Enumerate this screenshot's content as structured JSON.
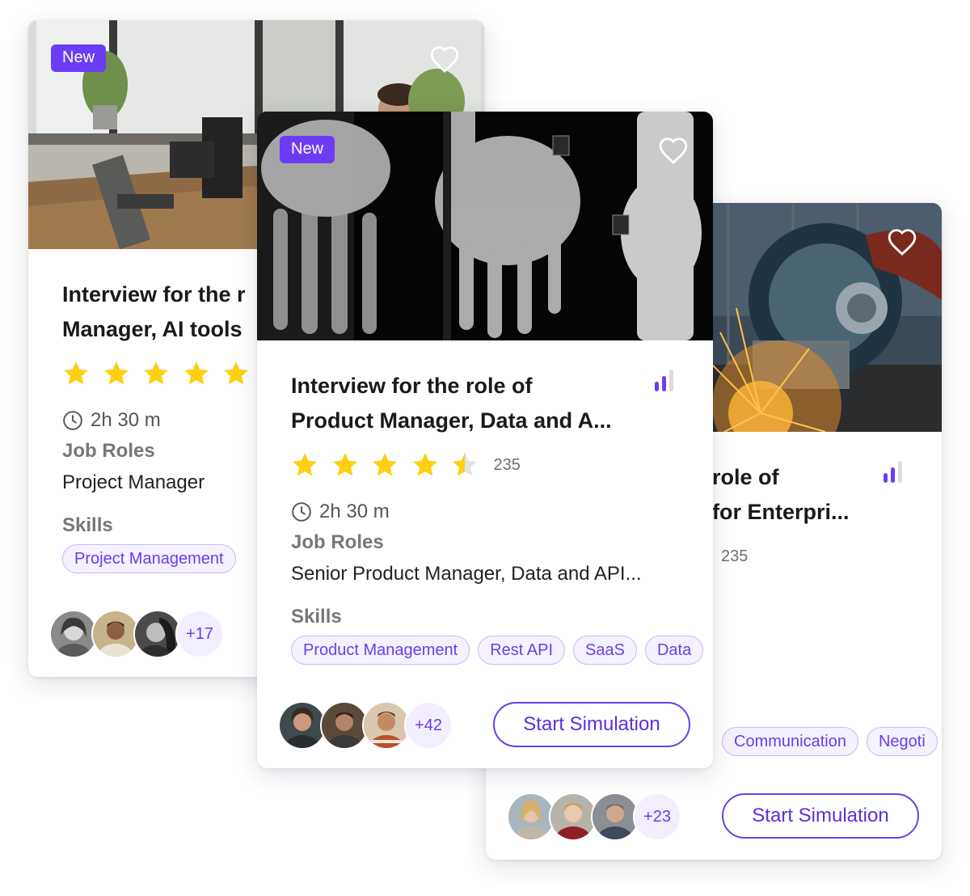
{
  "colors": {
    "accent": "#6c3cf5",
    "star": "#ffcf10",
    "chip_bg": "#f5f1ff",
    "chip_border": "#c9b8fb"
  },
  "cards": [
    {
      "badge": "New",
      "title_line1": "Interview for the r",
      "title_line2": "Manager, AI tools",
      "rating": 5,
      "duration": "2h 30 m",
      "job_roles_label": "Job Roles",
      "job_roles_value": "Project Manager",
      "skills_label": "Skills",
      "skills": [
        "Project Management"
      ],
      "participants_more": "+17",
      "image": "office-desk-photo"
    },
    {
      "badge": "New",
      "title_line1": "Interview for the role of",
      "title_line2": "Product Manager, Data and A...",
      "rating": 4.5,
      "rating_count": "235",
      "duration": "2h 30 m",
      "job_roles_label": "Job Roles",
      "job_roles_value": "Senior Product Manager, Data and API...",
      "skills_label": "Skills",
      "skills": [
        "Product Management",
        "Rest API",
        "SaaS",
        "Data"
      ],
      "participants_more": "+42",
      "cta": "Start Simulation",
      "image": "hand-xray-photo"
    },
    {
      "title_line1": "role of",
      "title_line2": "for Enterpri...",
      "rating_count": "235",
      "skills": [
        "Communication",
        "Negoti"
      ],
      "participants_more": "+23",
      "cta": "Start Simulation",
      "image": "metal-grinder-sparks-photo"
    }
  ]
}
